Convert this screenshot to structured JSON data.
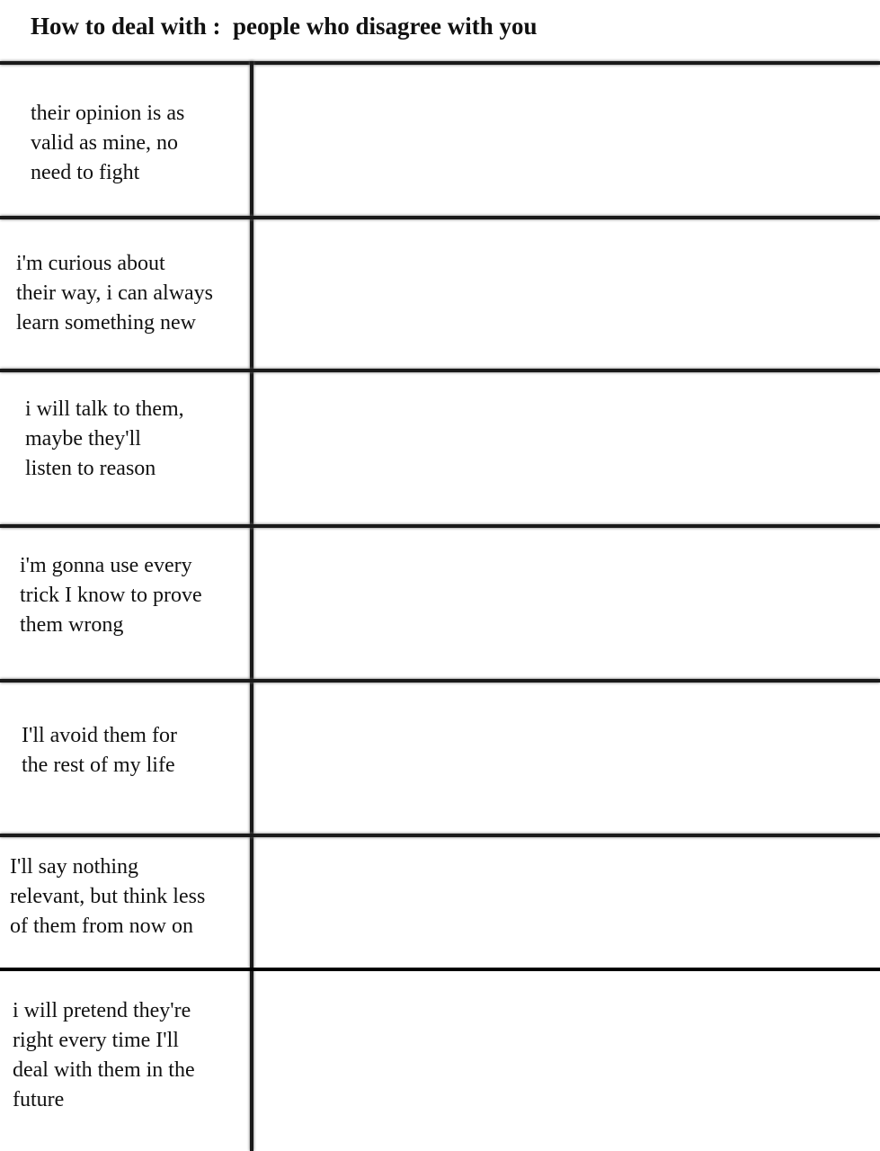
{
  "header": {
    "title": "How to deal with :  people who disagree with you"
  },
  "rows": [
    {
      "label": "their opinion is as\nvalid as mine, no\nneed to fight",
      "answer": ""
    },
    {
      "label": "i'm curious about\ntheir way, i can always\nlearn something new",
      "answer": ""
    },
    {
      "label": "i will talk to them,\nmaybe they'll\nlisten to reason",
      "answer": ""
    },
    {
      "label": "i'm gonna use every\ntrick I know to prove\nthem wrong",
      "answer": ""
    },
    {
      "label": "I'll avoid them for\nthe rest of my life",
      "answer": ""
    },
    {
      "label": "I'll say nothing\nrelevant, but think less\nof them from now on",
      "answer": ""
    },
    {
      "label": "i will pretend they're\nright every time I'll\ndeal with them in the\nfuture",
      "answer": ""
    }
  ]
}
